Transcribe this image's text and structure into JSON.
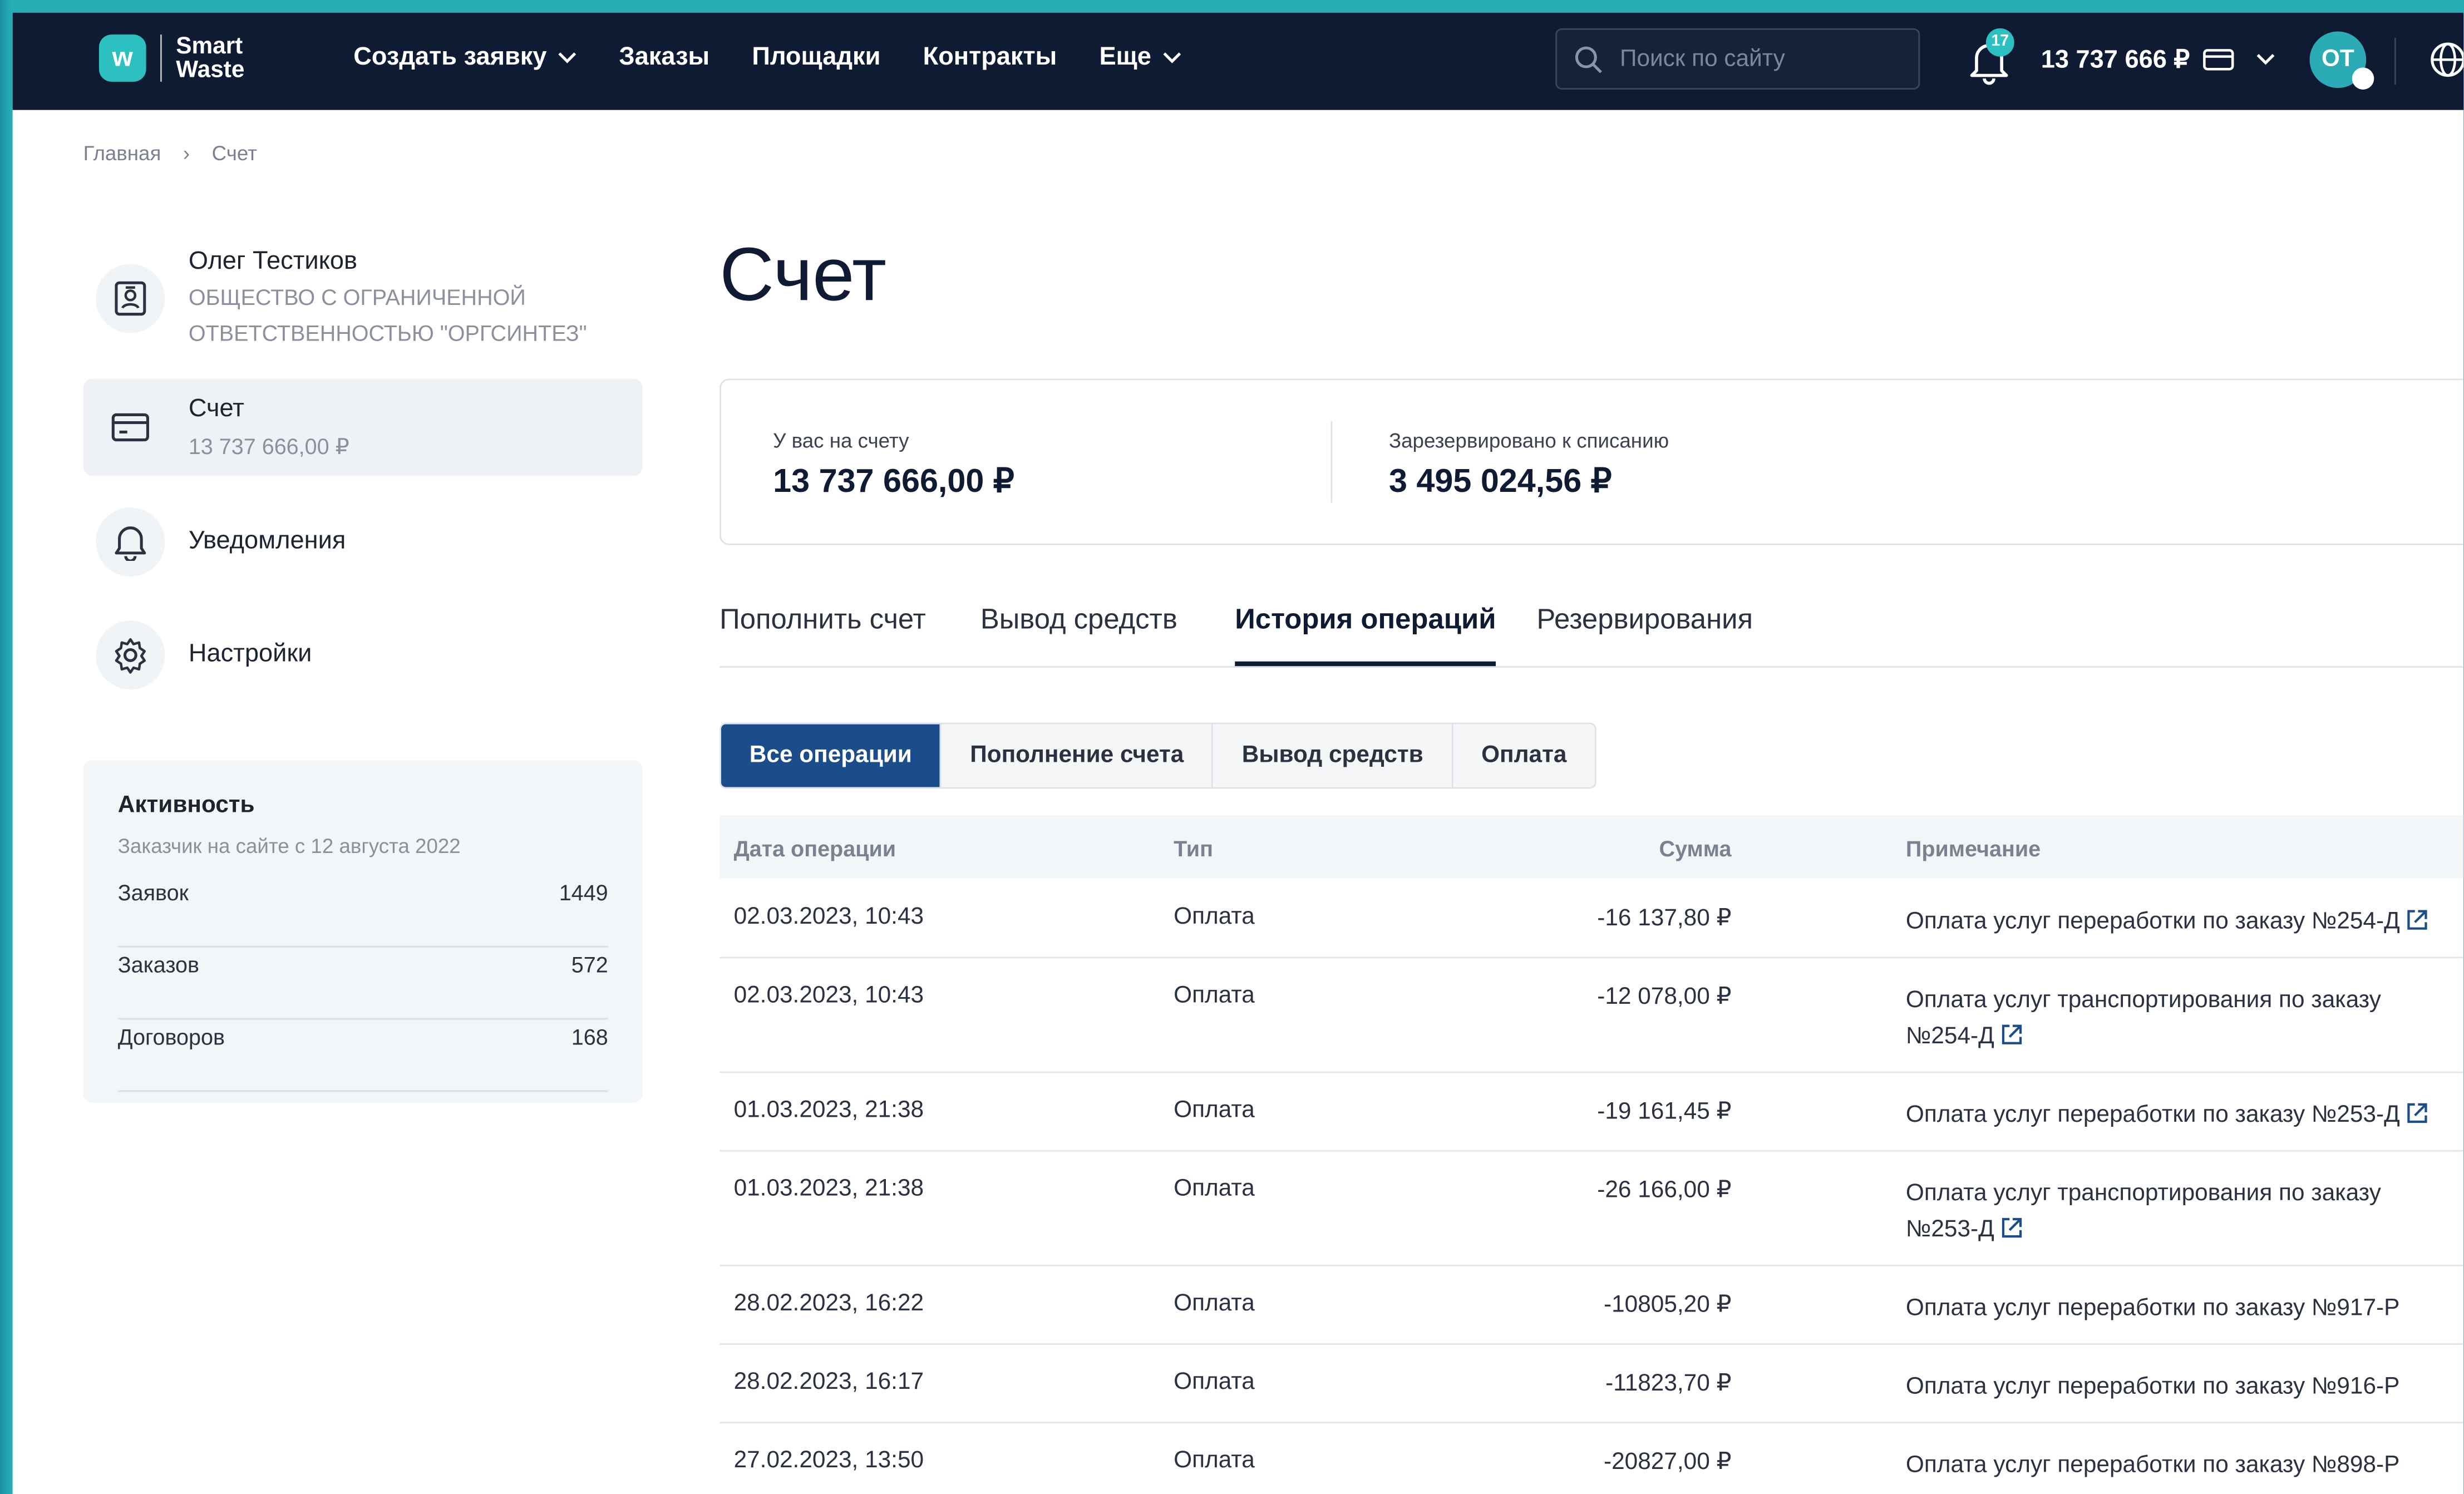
{
  "brand": {
    "name_line1": "Smart",
    "name_line2": "Waste",
    "logo_letter": "w",
    "accent": "#2cc0c0",
    "nav_bg": "#0f1b33"
  },
  "nav": {
    "create_request": "Создать заявку",
    "orders": "Заказы",
    "sites": "Площадки",
    "contracts": "Контракты",
    "more": "Еще"
  },
  "search": {
    "placeholder": "Поиск по сайту"
  },
  "header": {
    "notifications_count": "17",
    "balance": "13 737 666 ₽",
    "avatar_initials": "ОТ"
  },
  "breadcrumbs": {
    "home": "Главная",
    "separator": "›",
    "current": "Счет"
  },
  "sidebar": {
    "profile": {
      "name": "Олег Тестиков",
      "company": "ОБЩЕСТВО С ОГРАНИЧЕННОЙ ОТВЕТСТВЕННОСТЬЮ \"ОРГСИНТЕЗ\""
    },
    "account": {
      "label": "Счет",
      "amount": "13 737 666,00 ₽"
    },
    "notifications": {
      "label": "Уведомления"
    },
    "settings": {
      "label": "Настройки"
    }
  },
  "activity": {
    "title": "Активность",
    "subtitle": "Заказчик на сайте с 12 августа 2022",
    "rows": [
      {
        "label": "Заявок",
        "value": "1449"
      },
      {
        "label": "Заказов",
        "value": "572"
      },
      {
        "label": "Договоров",
        "value": "168"
      }
    ]
  },
  "page": {
    "title": "Счет"
  },
  "summary": {
    "balance_label": "У вас на счету",
    "balance_value": "13 737 666,00 ₽",
    "reserved_label": "Зарезервировано к списанию",
    "reserved_value": "3 495 024,56 ₽"
  },
  "tabs": [
    "Пополнить счет",
    "Вывод средств",
    "История операций",
    "Резервирования"
  ],
  "active_tab": "История операций",
  "filters": [
    "Все операции",
    "Пополнение счета",
    "Вывод средств",
    "Оплата"
  ],
  "active_filter": "Все операции",
  "table": {
    "headers": {
      "date": "Дата операции",
      "type": "Тип",
      "sum": "Сумма",
      "note": "Примечание"
    },
    "rows": [
      {
        "date": "02.03.2023, 10:43",
        "type": "Оплата",
        "sum": "-16 137,80 ₽",
        "note": "Оплата услуг переработки по заказу №254-Д",
        "link": true
      },
      {
        "date": "02.03.2023, 10:43",
        "type": "Оплата",
        "sum": "-12 078,00 ₽",
        "note": "Оплата услуг транспортирования по заказу №254-Д",
        "link": true
      },
      {
        "date": "01.03.2023, 21:38",
        "type": "Оплата",
        "sum": "-19 161,45 ₽",
        "note": "Оплата услуг переработки по заказу №253-Д",
        "link": true
      },
      {
        "date": "01.03.2023, 21:38",
        "type": "Оплата",
        "sum": "-26 166,00 ₽",
        "note": "Оплата услуг транспортирования по заказу №253-Д",
        "link": true
      },
      {
        "date": "28.02.2023, 16:22",
        "type": "Оплата",
        "sum": "-10805,20 ₽",
        "note": "Оплата услуг переработки по заказу №917-Р",
        "link": false
      },
      {
        "date": "28.02.2023, 16:17",
        "type": "Оплата",
        "sum": "-11823,70 ₽",
        "note": "Оплата услуг переработки по заказу №916-Р",
        "link": false
      },
      {
        "date": "27.02.2023, 13:50",
        "type": "Оплата",
        "sum": "-20827,00 ₽",
        "note": "Оплата услуг переработки по заказу №898-Р",
        "link": false
      }
    ]
  }
}
